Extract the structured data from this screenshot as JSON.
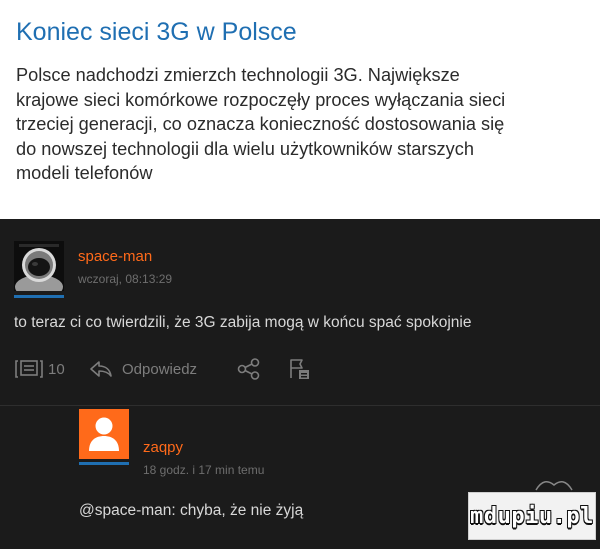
{
  "article": {
    "title": "Koniec sieci 3G w Polsce",
    "body_lines": [
      "Polsce nadchodzi zmierzch technologii 3G. Największe",
      "krajowe sieci komórkowe rozpoczęły proces wyłączania sieci",
      "trzeciej generacji, co oznacza konieczność dostosowania się",
      "do nowszej technologii dla wielu użytkowników starszych",
      "modeli telefonów"
    ]
  },
  "comments": [
    {
      "author": "space-man",
      "meta": "wczoraj, 08:13:29",
      "text": "to teraz ci co twierdzili, że 3G zabija mogą w końcu spać spokojnie",
      "actions": {
        "reply_count": "10",
        "reply_label": "Odpowiedz"
      },
      "avatar_icon": "astronaut-avatar"
    },
    {
      "author": "zaqpy",
      "meta": "18 godz. i 17 min temu",
      "text": "@space-man: chyba, że nie żyją",
      "avatar_icon": "default-user-avatar"
    }
  ],
  "watermark": "mdupiu.pl",
  "colors": {
    "title": "#1f6fb2",
    "author": "#ff6a1a",
    "comments_bg": "#1b1b1b",
    "avatar_orange": "#ff6a1a"
  }
}
